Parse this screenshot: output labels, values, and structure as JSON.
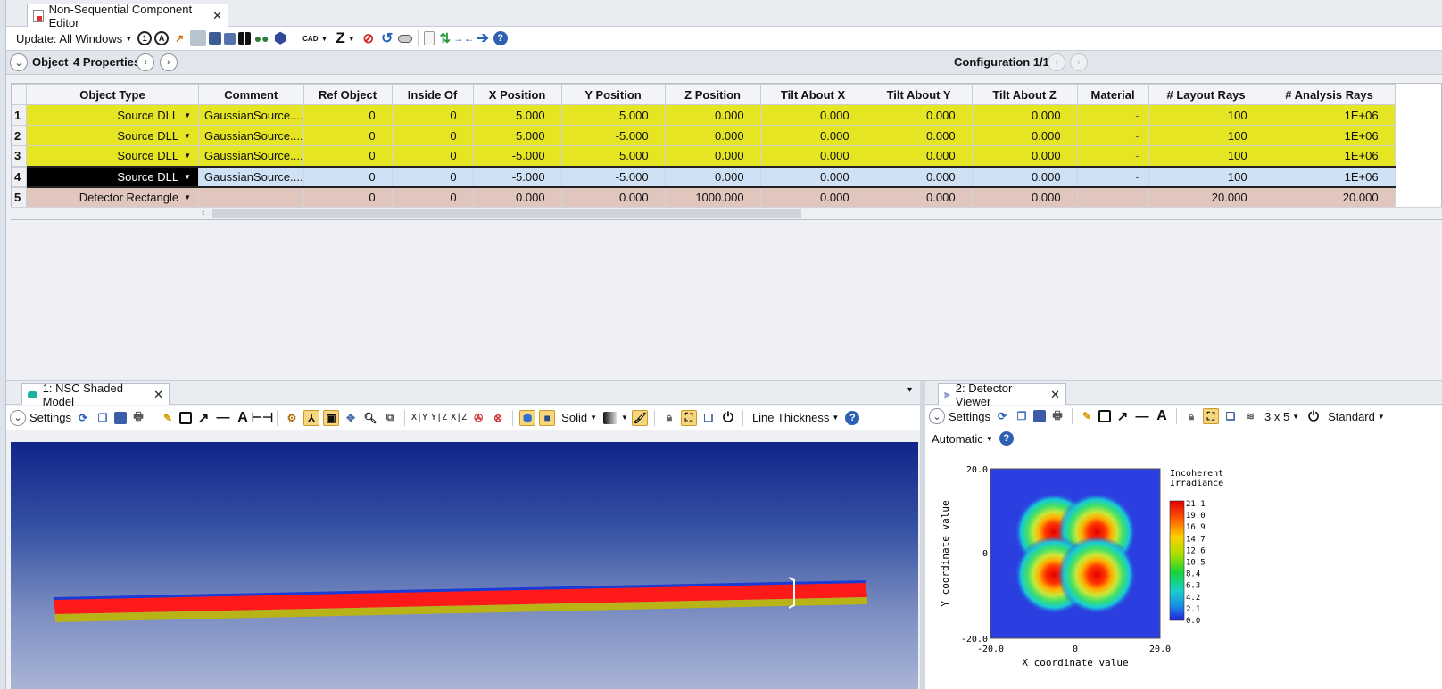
{
  "editor": {
    "tab_title": "Non-Sequential Component Editor",
    "update_label": "Update: All Windows",
    "cad_label": "CAD",
    "z_label": "Z"
  },
  "object_bar": {
    "object_label": "Object",
    "properties_label": "4 Properties",
    "configuration_label": "Configuration 1/1"
  },
  "table": {
    "columns": [
      "Object Type",
      "Comment",
      "Ref Object",
      "Inside Of",
      "X Position",
      "Y Position",
      "Z Position",
      "Tilt About X",
      "Tilt About Y",
      "Tilt About Z",
      "Material",
      "# Layout Rays",
      "# Analysis Rays"
    ],
    "rows": [
      {
        "num": "1",
        "type": "Source DLL",
        "comment": "GaussianSource....",
        "ref": "0",
        "inside": "0",
        "x": "5.000",
        "y": "5.000",
        "z": "0.000",
        "tx": "0.000",
        "ty": "0.000",
        "tz": "0.000",
        "material": "-",
        "layout": "100",
        "analysis": "1E+06"
      },
      {
        "num": "2",
        "type": "Source DLL",
        "comment": "GaussianSource....",
        "ref": "0",
        "inside": "0",
        "x": "5.000",
        "y": "-5.000",
        "z": "0.000",
        "tx": "0.000",
        "ty": "0.000",
        "tz": "0.000",
        "material": "-",
        "layout": "100",
        "analysis": "1E+06"
      },
      {
        "num": "3",
        "type": "Source DLL",
        "comment": "GaussianSource....",
        "ref": "0",
        "inside": "0",
        "x": "-5.000",
        "y": "5.000",
        "z": "0.000",
        "tx": "0.000",
        "ty": "0.000",
        "tz": "0.000",
        "material": "-",
        "layout": "100",
        "analysis": "1E+06"
      },
      {
        "num": "4",
        "type": "Source DLL",
        "comment": "GaussianSource....",
        "ref": "0",
        "inside": "0",
        "x": "-5.000",
        "y": "-5.000",
        "z": "0.000",
        "tx": "0.000",
        "ty": "0.000",
        "tz": "0.000",
        "material": "-",
        "layout": "100",
        "analysis": "1E+06"
      },
      {
        "num": "5",
        "type": "Detector Rectangle",
        "comment": "",
        "ref": "0",
        "inside": "0",
        "x": "0.000",
        "y": "0.000",
        "z": "1000.000",
        "tx": "0.000",
        "ty": "0.000",
        "tz": "0.000",
        "material": "",
        "layout": "20.000",
        "analysis": "20.000"
      }
    ]
  },
  "shaded_model": {
    "tab_title": "1: NSC Shaded Model",
    "settings_label": "Settings",
    "xy_label": "X|Y",
    "yz_label": "Y|Z",
    "xz_label": "X|Z",
    "solid_label": "Solid",
    "line_thickness_label": "Line Thickness"
  },
  "detector_viewer": {
    "tab_title": "2: Detector Viewer",
    "settings_label": "Settings",
    "grid_label": "3 x 5",
    "standard_label": "Standard",
    "automatic_label": "Automatic",
    "plot": {
      "legend_title_1": "Incoherent",
      "legend_title_2": "Irradiance",
      "y_top": "20.0",
      "y_mid": "0",
      "y_bottom": "-20.0",
      "x_left": "-20.0",
      "x_mid": "0",
      "x_right": "20.0",
      "x_label": "X coordinate value",
      "y_label": "Y coordinate value",
      "colorbar_ticks": [
        "21.1",
        "19.0",
        "16.9",
        "14.7",
        "12.6",
        "10.5",
        "8.4",
        "6.3",
        "4.2",
        "2.1",
        "0.0"
      ]
    }
  },
  "colors": {
    "source_row": "#e5e524",
    "detector_row": "#e0c6bd",
    "selected_row": "#cfe1f5"
  }
}
